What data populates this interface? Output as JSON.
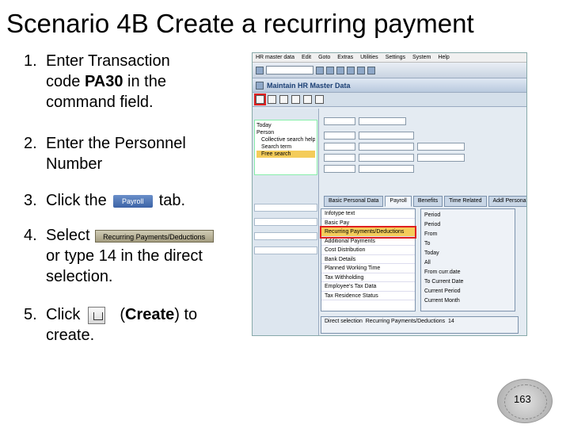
{
  "title": "Scenario 4B Create a recurring payment",
  "steps": [
    {
      "num": "1.",
      "pre": "Enter Transaction",
      "line2_pre": "code ",
      "bold": "PA30",
      "line2_post": " in the",
      "line3": "command field."
    },
    {
      "num": "2.",
      "line1": "Enter the Personnel",
      "line2": "Number"
    },
    {
      "num": "3.",
      "pre": "Click the",
      "button": "Payroll",
      "post": "tab."
    },
    {
      "num": "4.",
      "pre": "Select",
      "button": "Recurring Payments/Deductions",
      "line2": "or type 14 in the direct",
      "line3": "selection."
    },
    {
      "num": "5.",
      "pre": "Click",
      "bold": "Create",
      "post_bold": ") to",
      "open": "(",
      "line2": "create."
    }
  ],
  "sap": {
    "title": "Maintain HR Master Data",
    "menu": [
      "HR master data",
      "Edit",
      "Goto",
      "Extras",
      "Utilities",
      "Settings",
      "System",
      "Help"
    ],
    "tree": [
      "Today",
      "Person",
      "Collective search help",
      "Search term",
      "Free search"
    ],
    "tabs": [
      "Basic Personal Data",
      "Payroll",
      "Benefits",
      "Time Related",
      "Addl Personal Data"
    ],
    "infotypes": [
      "Infotype text",
      "Basic Pay",
      "Recurring Payments/Deductions",
      "Additional Payments",
      "Cost Distribution",
      "Bank Details",
      "Planned Working Time",
      "Tax Withholding",
      "Employee's Tax Data",
      "Tax Residence Status"
    ],
    "period": [
      "Period",
      "Period",
      "From",
      "To",
      "Today",
      "All",
      "From curr.date",
      "To Current Date",
      "Current Period",
      "Current Month"
    ],
    "direct_label": "Direct selection",
    "direct_value": "Recurring Payments/Deductions",
    "direct_code": "14"
  },
  "page_number": "163"
}
